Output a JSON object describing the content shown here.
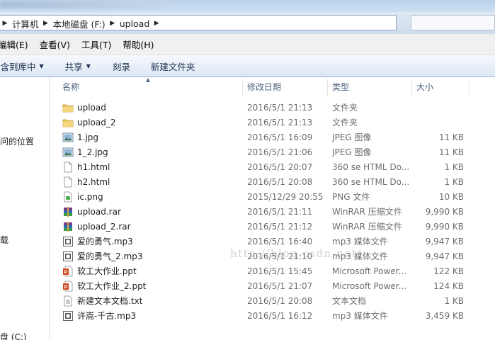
{
  "address": {
    "crumbs": [
      "计算机",
      "本地磁盘 (F:)",
      "upload"
    ]
  },
  "menu": {
    "items": [
      "编辑(E)",
      "查看(V)",
      "工具(T)",
      "帮助(H)"
    ]
  },
  "toolbar": {
    "include_library": "包含到库中",
    "share": "共享",
    "burn": "刻录",
    "new_folder": "新建文件夹"
  },
  "nav": {
    "recent_places": "访问的位置",
    "downloads": "下载",
    "local_disk_c": "磁盘 (C:)"
  },
  "columns": {
    "name": "名称",
    "date": "修改日期",
    "type": "类型",
    "size": "大小"
  },
  "files": [
    {
      "icon": "folder-icon",
      "name": "upload",
      "date": "2016/5/1 21:13",
      "type": "文件夹",
      "size": ""
    },
    {
      "icon": "folder-icon",
      "name": "upload_2",
      "date": "2016/5/1 21:13",
      "type": "文件夹",
      "size": ""
    },
    {
      "icon": "jpeg-image-icon",
      "name": "1.jpg",
      "date": "2016/5/1 16:09",
      "type": "JPEG 图像",
      "size": "11 KB"
    },
    {
      "icon": "jpeg-image-icon",
      "name": "1_2.jpg",
      "date": "2016/5/1 21:06",
      "type": "JPEG 图像",
      "size": "11 KB"
    },
    {
      "icon": "html-file-icon",
      "name": "h1.html",
      "date": "2016/5/1 20:07",
      "type": "360 se HTML Do...",
      "size": "1 KB"
    },
    {
      "icon": "html-file-icon",
      "name": "h2.html",
      "date": "2016/5/1 20:08",
      "type": "360 se HTML Do...",
      "size": "1 KB"
    },
    {
      "icon": "png-image-icon",
      "name": "ic.png",
      "date": "2015/12/29 20:55",
      "type": "PNG 文件",
      "size": "10 KB"
    },
    {
      "icon": "rar-archive-icon",
      "name": "upload.rar",
      "date": "2016/5/1 21:11",
      "type": "WinRAR 压缩文件",
      "size": "9,990 KB"
    },
    {
      "icon": "rar-archive-icon",
      "name": "upload_2.rar",
      "date": "2016/5/1 21:12",
      "type": "WinRAR 压缩文件",
      "size": "9,990 KB"
    },
    {
      "icon": "mp3-audio-icon",
      "name": "爱的勇气.mp3",
      "date": "2016/5/1 16:40",
      "type": "mp3 媒体文件",
      "size": "9,947 KB"
    },
    {
      "icon": "mp3-audio-icon",
      "name": "爱的勇气_2.mp3",
      "date": "2016/5/1 21:10",
      "type": "mp3 媒体文件",
      "size": "9,947 KB"
    },
    {
      "icon": "ppt-file-icon",
      "name": "软工大作业.ppt",
      "date": "2016/5/1 15:45",
      "type": "Microsoft Power...",
      "size": "122 KB"
    },
    {
      "icon": "ppt-file-icon",
      "name": "软工大作业_2.ppt",
      "date": "2016/5/1 21:07",
      "type": "Microsoft Power...",
      "size": "124 KB"
    },
    {
      "icon": "text-file-icon",
      "name": "新建文本文档.txt",
      "date": "2016/5/1 20:08",
      "type": "文本文档",
      "size": "1 KB"
    },
    {
      "icon": "mp3-audio-icon",
      "name": "许嵩-千古.mp3",
      "date": "2016/5/1 16:12",
      "type": "mp3 媒体文件",
      "size": "3,459 KB"
    }
  ],
  "watermark": "http://blog.csdn.net/"
}
